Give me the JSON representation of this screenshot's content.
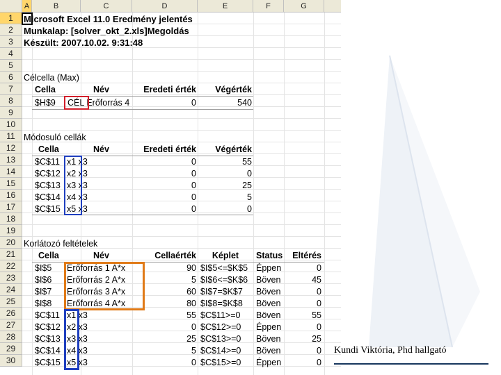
{
  "columns": [
    "A",
    "B",
    "C",
    "D",
    "E",
    "F",
    "G"
  ],
  "rows": [
    "1",
    "2",
    "3",
    "4",
    "5",
    "6",
    "7",
    "8",
    "9",
    "10",
    "11",
    "12",
    "13",
    "14",
    "15",
    "16",
    "17",
    "18",
    "19",
    "20",
    "21",
    "22",
    "23",
    "24",
    "25",
    "26",
    "27",
    "28",
    "29",
    "30"
  ],
  "report": {
    "title": "Microsoft Excel 11.0 Eredmény jelentés",
    "sheet": "Munkalap: [solver_okt_2.xls]Megoldás",
    "created": "Készült: 2007.10.02. 9:31:48"
  },
  "target": {
    "section": "Célcella (Max)",
    "headers": [
      "Cella",
      "Név",
      "Eredeti érték",
      "Végérték"
    ],
    "row": {
      "cell": "$H$9",
      "name": "CÉL Erőforrás 4",
      "orig": "0",
      "final": "540"
    }
  },
  "changing": {
    "section": "Módosuló cellák",
    "headers": [
      "Cella",
      "Név",
      "Eredeti érték",
      "Végérték"
    ],
    "rows": [
      {
        "cell": "$C$11",
        "name": "x1 x3",
        "orig": "0",
        "final": "55"
      },
      {
        "cell": "$C$12",
        "name": "x2 x3",
        "orig": "0",
        "final": "0"
      },
      {
        "cell": "$C$13",
        "name": "x3 x3",
        "orig": "0",
        "final": "25"
      },
      {
        "cell": "$C$14",
        "name": "x4 x3",
        "orig": "0",
        "final": "5"
      },
      {
        "cell": "$C$15",
        "name": "x5 x3",
        "orig": "0",
        "final": "0"
      }
    ]
  },
  "constraints": {
    "section": "Korlátozó feltételek",
    "headers": [
      "Cella",
      "Név",
      "Cellaérték",
      "Képlet",
      "Status",
      "Eltérés"
    ],
    "rows": [
      {
        "cell": "$I$5",
        "name": "Erőforrás 1 A*x",
        "value": "90",
        "formula": "$I$5<=$K$5",
        "status": "Éppen",
        "slack": "0"
      },
      {
        "cell": "$I$6",
        "name": "Erőforrás 2 A*x",
        "value": "5",
        "formula": "$I$6<=$K$6",
        "status": "Böven",
        "slack": "45"
      },
      {
        "cell": "$I$7",
        "name": "Erőforrás 3 A*x",
        "value": "60",
        "formula": "$I$7=$K$7",
        "status": "Böven",
        "slack": "0"
      },
      {
        "cell": "$I$8",
        "name": "Erőforrás 4 A*x",
        "value": "80",
        "formula": "$I$8=$K$8",
        "status": "Böven",
        "slack": "0"
      },
      {
        "cell": "$C$11",
        "name": "x1 x3",
        "value": "55",
        "formula": "$C$11>=0",
        "status": "Böven",
        "slack": "55"
      },
      {
        "cell": "$C$12",
        "name": "x2 x3",
        "value": "0",
        "formula": "$C$12>=0",
        "status": "Éppen",
        "slack": "0"
      },
      {
        "cell": "$C$13",
        "name": "x3 x3",
        "value": "25",
        "formula": "$C$13>=0",
        "status": "Böven",
        "slack": "25"
      },
      {
        "cell": "$C$14",
        "name": "x4 x3",
        "value": "5",
        "formula": "$C$14>=0",
        "status": "Böven",
        "slack": "0"
      },
      {
        "cell": "$C$15",
        "name": "x5 x3",
        "value": "0",
        "formula": "$C$15>=0",
        "status": "Éppen",
        "slack": "0"
      }
    ]
  },
  "footer": "Kundi Viktória, Phd hallgató",
  "colors": {
    "red": "#d21f2b",
    "blue": "#1f3fbf",
    "orange": "#e07a17",
    "header_bg": "#ece9d8",
    "selected": "#ffd66b"
  }
}
